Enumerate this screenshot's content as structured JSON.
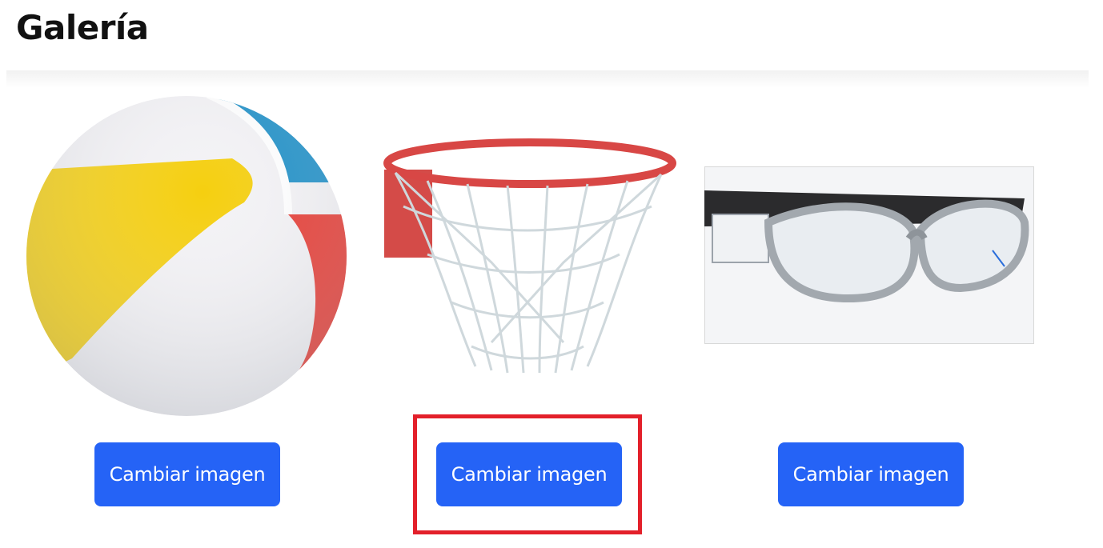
{
  "page": {
    "title": "Galería"
  },
  "gallery": {
    "items": [
      {
        "image": "beach-ball-image",
        "button_label": "Cambiar imagen"
      },
      {
        "image": "basketball-hoop-image",
        "button_label": "Cambiar imagen"
      },
      {
        "image": "sports-goggles-image",
        "button_label": "Cambiar imagen"
      }
    ]
  },
  "colors": {
    "button": "#2563f6",
    "highlight": "#e3202a"
  }
}
